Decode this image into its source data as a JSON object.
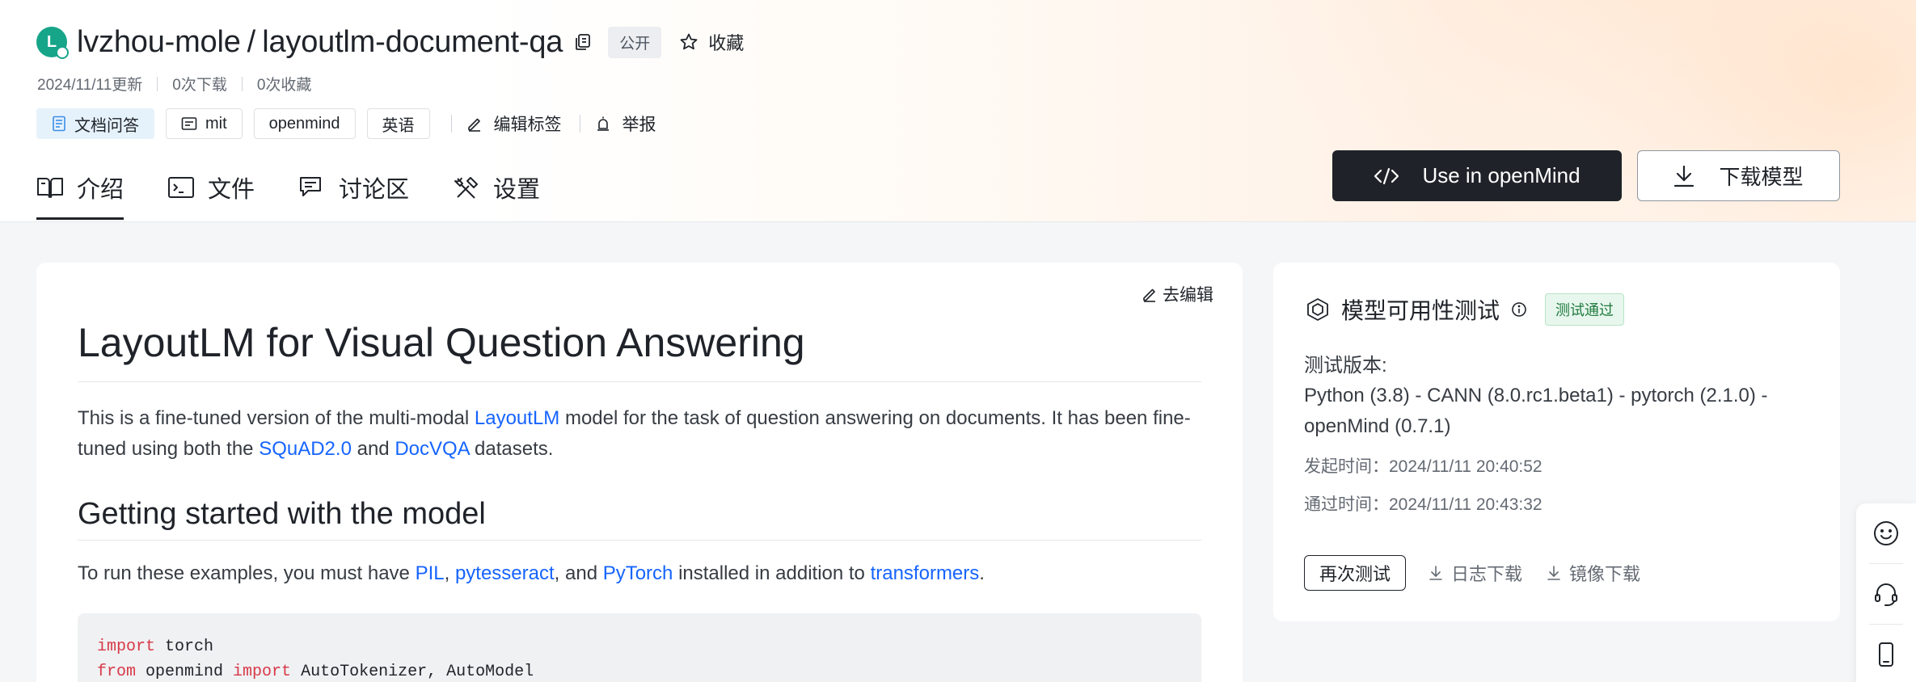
{
  "repo": {
    "avatar_letter": "L",
    "owner": "lvzhou-mole",
    "separator": "/",
    "name": "layoutlm-document-qa",
    "visibility": "公开",
    "favorite_label": "收藏",
    "updated": "2024/11/11更新",
    "downloads": "0次下载",
    "favorites": "0次收藏"
  },
  "tags": {
    "task": "文档问答",
    "license": "mit",
    "framework": "openmind",
    "language": "英语",
    "edit_label": "编辑标签",
    "report_label": "举报"
  },
  "tabs": [
    {
      "label": "介绍",
      "icon": "book-icon"
    },
    {
      "label": "文件",
      "icon": "folder-icon"
    },
    {
      "label": "讨论区",
      "icon": "chat-icon"
    },
    {
      "label": "设置",
      "icon": "tools-icon"
    }
  ],
  "actions": {
    "use_openmind": "Use in openMind",
    "download_model": "下载模型"
  },
  "readme": {
    "edit_link": "去编辑",
    "title": "LayoutLM for Visual Question Answering",
    "intro_1": "This is a fine-tuned version of the multi-modal ",
    "intro_link_1": "LayoutLM",
    "intro_2": " model for the task of question answering on documents. It has been fine-tuned using both the ",
    "intro_link_2": "SQuAD2.0",
    "intro_3": " and ",
    "intro_link_3": "DocVQA",
    "intro_4": " datasets.",
    "h2": "Getting started with the model",
    "run_1": "To run these examples, you must have ",
    "run_link_1": "PIL",
    "run_2": ", ",
    "run_link_2": "pytesseract",
    "run_3": ", and ",
    "run_link_3": "PyTorch",
    "run_4": " installed in addition to ",
    "run_link_4": "transformers",
    "run_5": ".",
    "code": {
      "l1_kw": "import",
      "l1_rest": " torch",
      "l2_kw1": "from",
      "l2_mid": " openmind ",
      "l2_kw2": "import",
      "l2_rest": " AutoTokenizer, AutoModel"
    }
  },
  "test": {
    "title": "模型可用性测试",
    "status": "测试通过",
    "version_label": "测试版本:",
    "version_value": "Python (3.8) - CANN (8.0.rc1.beta1) - pytorch (2.1.0) - openMind (0.7.1)",
    "start_time": "发起时间：2024/11/11 20:40:52",
    "pass_time": "通过时间：2024/11/11 20:43:32",
    "retest": "再次测试",
    "log_download": "日志下载",
    "image_download": "镜像下载"
  },
  "colors": {
    "accent_dark": "#1f2329",
    "link": "#1664ff",
    "avatar": "#17a589",
    "pass_green": "#1f7a3d"
  }
}
